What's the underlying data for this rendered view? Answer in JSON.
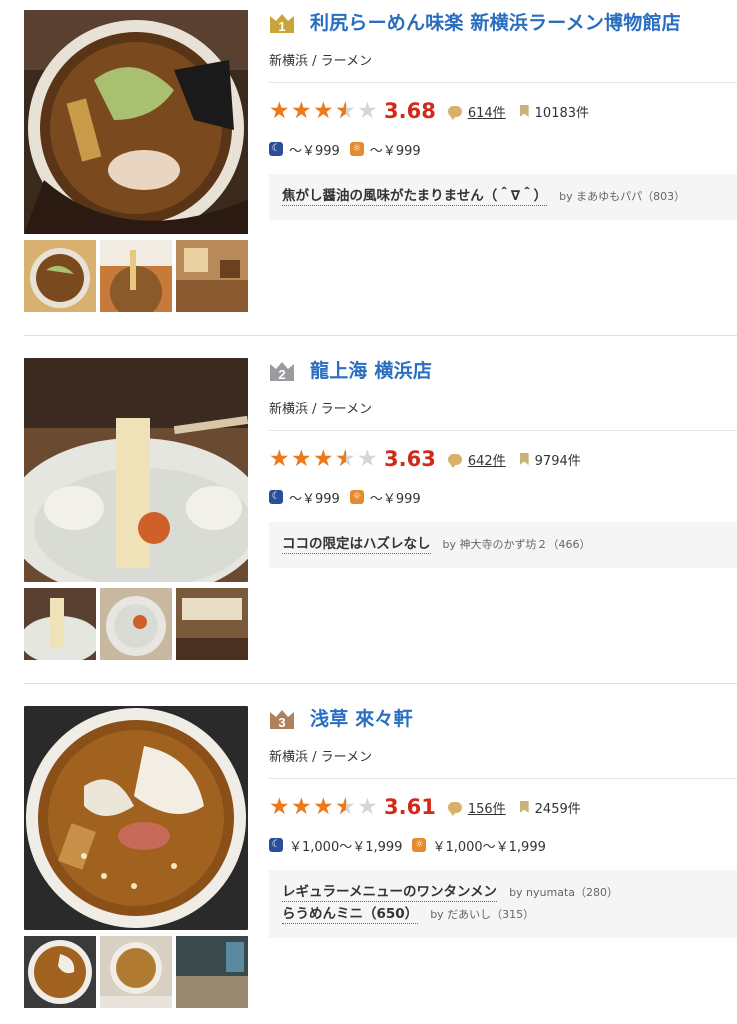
{
  "colors": {
    "link": "#2a6ec0",
    "score": "#d12a1a",
    "star": "#ea7a1c",
    "gold": "#c9a43a",
    "silver": "#9a9aa0",
    "bronze": "#b0805a"
  },
  "entries": [
    {
      "rank": "1",
      "rank_icon": "gold-crown-icon",
      "name": "利尻らーめん味楽 新横浜ラーメン博物館店",
      "area": "新横浜 / ラーメン",
      "rating": 3.68,
      "score": "3.68",
      "reviews": "614件",
      "bookmarks": "10183件",
      "dinner_price": "～￥999",
      "lunch_price": "～￥999",
      "review_snippets": [
        {
          "title": "焦がし醤油の風味がたまりません（＾∇＾）",
          "by": "by まあゆもパパ（803）"
        }
      ]
    },
    {
      "rank": "2",
      "rank_icon": "silver-crown-icon",
      "name": "龍上海 横浜店",
      "area": "新横浜 / ラーメン",
      "rating": 3.63,
      "score": "3.63",
      "reviews": "642件",
      "bookmarks": "9794件",
      "dinner_price": "～￥999",
      "lunch_price": "～￥999",
      "review_snippets": [
        {
          "title": "ココの限定はハズレなし",
          "by": "by 神大寺のかず坊２（466）"
        }
      ]
    },
    {
      "rank": "3",
      "rank_icon": "bronze-crown-icon",
      "name": "浅草 來々軒",
      "area": "新横浜 / ラーメン",
      "rating": 3.61,
      "score": "3.61",
      "reviews": "156件",
      "bookmarks": "2459件",
      "dinner_price": "￥1,000～￥1,999",
      "lunch_price": "￥1,000～￥1,999",
      "review_snippets": [
        {
          "title": "レギュラーメニューのワンタンメン",
          "by": "by nyumata（280）"
        },
        {
          "title": "らうめんミニ（650）",
          "by": "by だあいし（315）"
        }
      ]
    }
  ]
}
